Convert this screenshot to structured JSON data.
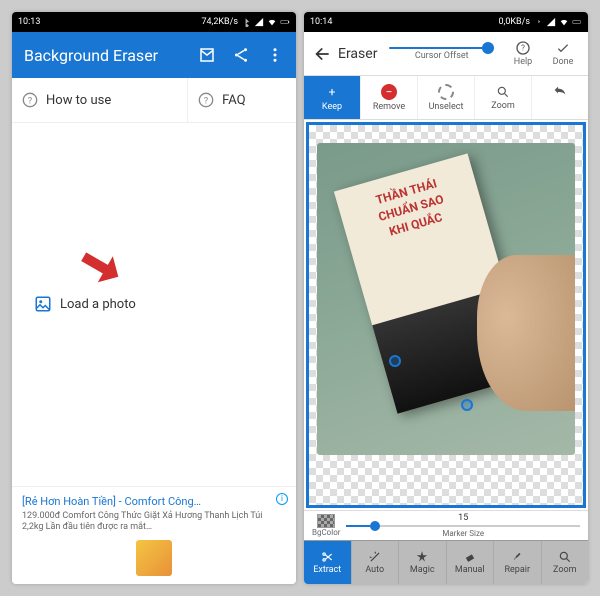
{
  "phone1": {
    "status": {
      "time": "10:13",
      "net": "74,2KB/s"
    },
    "appbar": {
      "title": "Background Eraser"
    },
    "help": {
      "howto": "How to use",
      "faq": "FAQ"
    },
    "load": "Load a photo",
    "ad": {
      "title": "[Rẻ Hơn Hoàn Tiền] - Comfort Công…",
      "desc": "129.000đ Comfort Công Thức Giặt Xả Hương Thanh Lịch Túi 2,2kg Lần đầu tiên được ra mắt…"
    }
  },
  "phone2": {
    "status": {
      "time": "10:14",
      "net": "0,0KB/s"
    },
    "topbar": {
      "title": "Eraser",
      "cursor": "Cursor Offset",
      "help": "Help",
      "done": "Done"
    },
    "tools": {
      "keep": "Keep",
      "remove": "Remove",
      "unselect": "Unselect",
      "zoom": "Zoom"
    },
    "book": {
      "l1": "THẦN THÁI",
      "l2": "CHUẨN SAO",
      "l3": "KHI QUẮC"
    },
    "marker": {
      "bgcolor": "BgColor",
      "value": "15",
      "label": "Marker Size"
    },
    "bottom": {
      "extract": "Extract",
      "auto": "Auto",
      "magic": "Magic",
      "manual": "Manual",
      "repair": "Repair",
      "zoom": "Zoom"
    }
  }
}
